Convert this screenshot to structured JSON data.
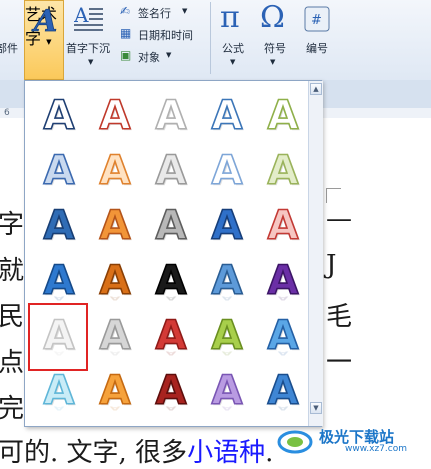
{
  "ribbon": {
    "part_label": "部件",
    "wordart_label": "艺术字",
    "dropcap_label": "首字下沉",
    "signature_label": "签名行",
    "datetime_label": "日期和时间",
    "object_label": "对象",
    "equation_label": "公式",
    "symbol_label": "符号",
    "numbering_label": "编号"
  },
  "ruler": {
    "mark_6": "6"
  },
  "document": {
    "lines": [
      "字是",
      "就这",
      "民种",
      "点话",
      "完有",
      "可的. 文字, 很多"
    ],
    "link_text": "小语种",
    "tail": ".",
    "right_chars": [
      "—",
      "J",
      "毛",
      "一"
    ]
  },
  "gallery": {
    "letter": "A",
    "styles": [
      {
        "fill": "#ffffff",
        "stroke": "#1f3f73",
        "grad": "none"
      },
      {
        "fill": "#ffffff",
        "stroke": "#c0392b",
        "grad": "none"
      },
      {
        "fill": "#ffffff",
        "stroke": "#b0b0b0",
        "grad": "none"
      },
      {
        "fill": "#ffffff",
        "stroke": "#3c76b8",
        "grad": "none"
      },
      {
        "fill": "#ffffff",
        "stroke": "#8fb04a",
        "grad": "none"
      },
      {
        "fill": "#c9d9ef",
        "stroke": "#3c6ab0",
        "grad": "none"
      },
      {
        "fill": "#ffe2c2",
        "stroke": "#e0822e",
        "grad": "none"
      },
      {
        "fill": "#e9e9e9",
        "stroke": "#9a9a9a",
        "grad": "none"
      },
      {
        "fill": "#ffffff",
        "stroke": "#7ea6d8",
        "grad": "none"
      },
      {
        "fill": "#e3edc9",
        "stroke": "#9ab35b",
        "grad": "none"
      },
      {
        "fill": "#2f6cb5",
        "stroke": "#183e74",
        "grad": "none"
      },
      {
        "fill": "#f29538",
        "stroke": "#b4541a",
        "grad": "none"
      },
      {
        "fill": "#b8b8b8",
        "stroke": "#5e5e5e",
        "grad": "none"
      },
      {
        "fill": "#2f70c9",
        "stroke": "#163e7a",
        "grad": "none"
      },
      {
        "fill": "#f6c6c2",
        "stroke": "#c33a35",
        "grad": "none"
      },
      {
        "fill": "#2e79cf",
        "stroke": "#154a8a",
        "grad": "none"
      },
      {
        "fill": "#d97018",
        "stroke": "#8a3f05",
        "grad": "none"
      },
      {
        "fill": "#1a1a1a",
        "stroke": "#000000",
        "grad": "none"
      },
      {
        "fill": "#5d9ad9",
        "stroke": "#2a5d94",
        "grad": "none"
      },
      {
        "fill": "#6b2fa6",
        "stroke": "#3c1567",
        "grad": "none"
      },
      {
        "fill": "#f4f4f4",
        "stroke": "#c4c4c4",
        "grad": "none"
      },
      {
        "fill": "#d6d6d6",
        "stroke": "#9a9a9a",
        "grad": "none"
      },
      {
        "fill": "#d33a36",
        "stroke": "#8f1a17",
        "grad": "none"
      },
      {
        "fill": "#a8cf4b",
        "stroke": "#6a8f20",
        "grad": "none"
      },
      {
        "fill": "#5aa6e6",
        "stroke": "#2460a5",
        "grad": "none"
      },
      {
        "fill": "#c9ecf7",
        "stroke": "#5fb6d8",
        "grad": "none"
      },
      {
        "fill": "#f6a23c",
        "stroke": "#c66a12",
        "grad": "none"
      },
      {
        "fill": "#a8231f",
        "stroke": "#5e0e0c",
        "grad": "none"
      },
      {
        "fill": "#b99be2",
        "stroke": "#7a56b4",
        "grad": "none"
      },
      {
        "fill": "#3f86d4",
        "stroke": "#1a4e8e",
        "grad": "none"
      }
    ]
  },
  "watermark": {
    "text": "极光下载站",
    "url": "www.xz7.com"
  },
  "colors": {
    "link": "#1a1aff",
    "selection": "#e02424"
  }
}
